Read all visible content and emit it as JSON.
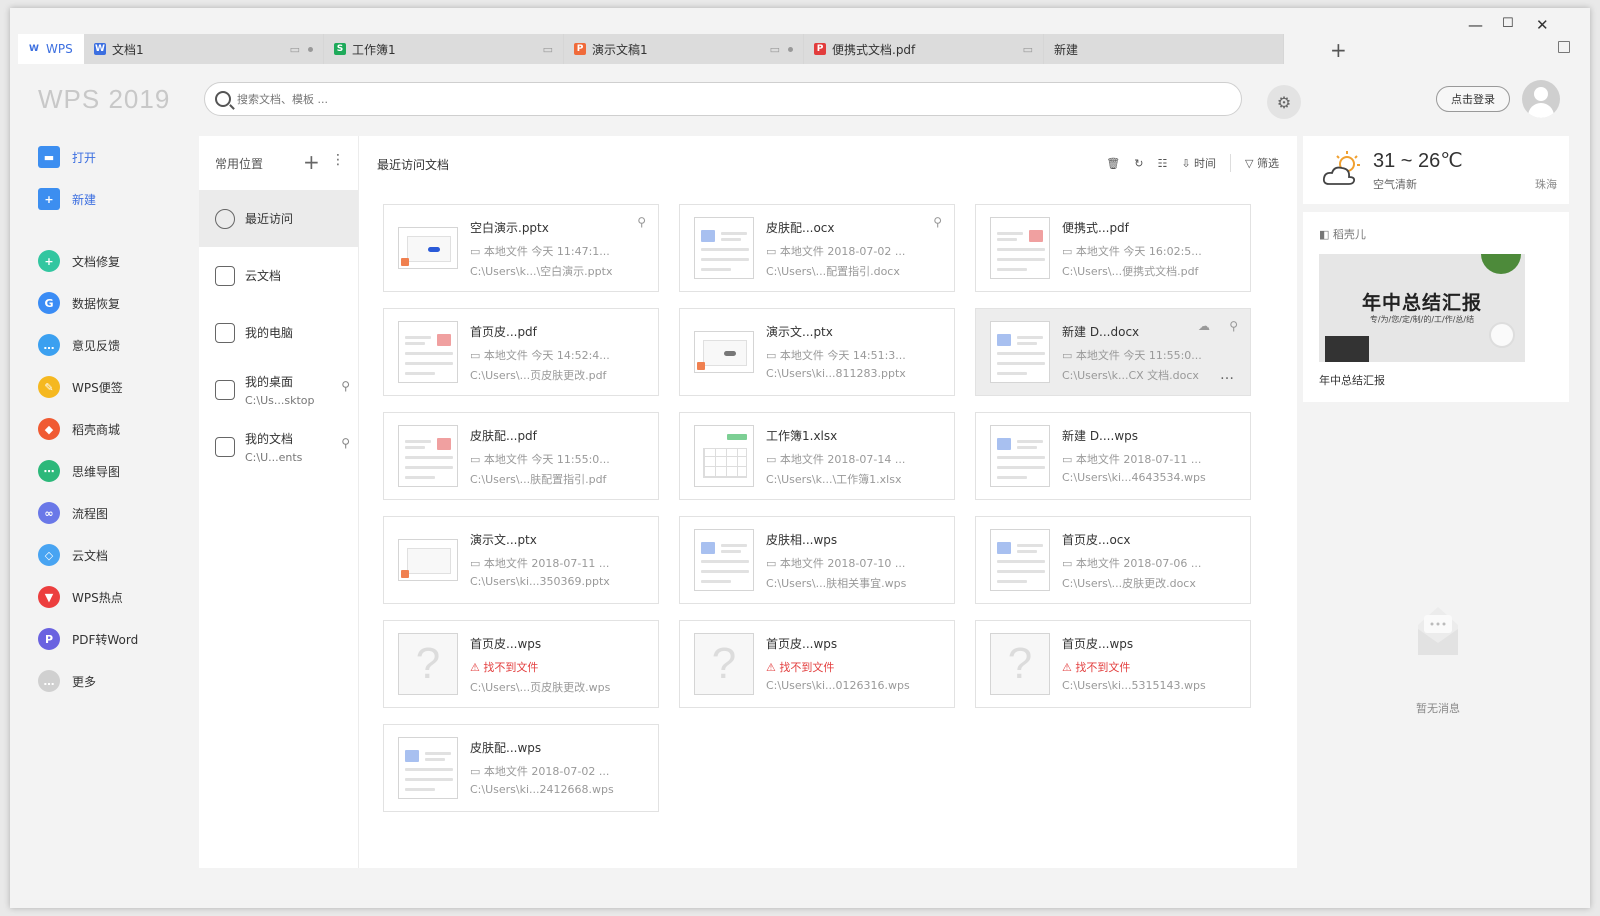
{
  "app": {
    "logo_text": "WPS 2019"
  },
  "tabs": [
    {
      "label": "WPS",
      "kind": "home",
      "color": "#3c6fe0",
      "icon": "W"
    },
    {
      "label": "文档1",
      "kind": "doc",
      "color": "#3c6fe0",
      "icon": "W"
    },
    {
      "label": "工作簿1",
      "kind": "sheet",
      "color": "#1eaa5a",
      "icon": "S"
    },
    {
      "label": "演示文稿1",
      "kind": "ppt",
      "color": "#f06a3a",
      "icon": "P"
    },
    {
      "label": "便携式文档.pdf",
      "kind": "pdf",
      "color": "#e23c3c",
      "icon": "P"
    },
    {
      "label": "新建",
      "kind": "new",
      "color": "",
      "icon": ""
    }
  ],
  "search": {
    "placeholder": "搜索文档、模板 ..."
  },
  "header": {
    "login_label": "点击登录"
  },
  "leftnav": [
    {
      "label": "打开",
      "icon": "folder-icon",
      "color": "#3c8ef0",
      "accent": true
    },
    {
      "label": "新建",
      "icon": "plus-icon",
      "color": "#3c8ef0",
      "accent": true
    },
    {
      "label": "文档修复",
      "icon": "repair-icon",
      "color": "#32c6a0"
    },
    {
      "label": "数据恢复",
      "icon": "recover-icon",
      "color": "#3a8cf5"
    },
    {
      "label": "意见反馈",
      "icon": "feedback-icon",
      "color": "#3ba0f0"
    },
    {
      "label": "WPS便签",
      "icon": "note-icon",
      "color": "#f5b820"
    },
    {
      "label": "稻壳商城",
      "icon": "shop-icon",
      "color": "#f05a32"
    },
    {
      "label": "思维导图",
      "icon": "mindmap-icon",
      "color": "#2cb87a"
    },
    {
      "label": "流程图",
      "icon": "flowchart-icon",
      "color": "#6a78e8"
    },
    {
      "label": "云文档",
      "icon": "cloud-doc-icon",
      "color": "#48a4f2"
    },
    {
      "label": "WPS热点",
      "icon": "hot-icon",
      "color": "#ec3e3e"
    },
    {
      "label": "PDF转Word",
      "icon": "pdf-word-icon",
      "color": "#6a62e0"
    },
    {
      "label": "更多",
      "icon": "more-icon",
      "color": "#d0d0d0"
    }
  ],
  "places": {
    "title": "常用位置",
    "items": [
      {
        "label": "最近访问",
        "sub": "",
        "icon": "clock-icon"
      },
      {
        "label": "云文档",
        "sub": "",
        "icon": "box-icon"
      },
      {
        "label": "我的电脑",
        "sub": "",
        "icon": "computer-icon"
      },
      {
        "label": "我的桌面",
        "sub": "C:\\Us...sktop",
        "icon": "desktop-icon"
      },
      {
        "label": "我的文档",
        "sub": "C:\\U...ents",
        "icon": "documents-icon"
      }
    ]
  },
  "content": {
    "title": "最近访问文档",
    "sort_label": "时间",
    "filter_label": "筛选"
  },
  "files": [
    {
      "name": "空白演示.pptx",
      "meta": "本地文件  今天 11:47:1...",
      "path": "C:\\Users\\k...\\空白演示.pptx",
      "type": "ppt",
      "pinned": true
    },
    {
      "name": "皮肤配...ocx",
      "meta": "本地文件  2018-07-02 ...",
      "path": "C:\\Users\\...配置指引.docx",
      "type": "doc",
      "pinned": true
    },
    {
      "name": "便携式...pdf",
      "meta": "本地文件  今天 16:02:5...",
      "path": "C:\\Users\\...便携式文档.pdf",
      "type": "pdf"
    },
    {
      "name": "首页皮...pdf",
      "meta": "本地文件  今天 14:52:4...",
      "path": "C:\\Users\\...页皮肤更改.pdf",
      "type": "pdf"
    },
    {
      "name": "演示文...ptx",
      "meta": "本地文件  今天 14:51:3...",
      "path": "C:\\Users\\ki...811283.pptx",
      "type": "ppt2"
    },
    {
      "name": "新建 D...docx",
      "meta": "本地文件  今天 11:55:0...",
      "path": "C:\\Users\\k...CX 文档.docx",
      "type": "doc",
      "hover": true
    },
    {
      "name": "皮肤配...pdf",
      "meta": "本地文件  今天 11:55:0...",
      "path": "C:\\Users\\...肤配置指引.pdf",
      "type": "pdf"
    },
    {
      "name": "工作簿1.xlsx",
      "meta": "本地文件  2018-07-14 ...",
      "path": "C:\\Users\\k...\\工作簿1.xlsx",
      "type": "xls"
    },
    {
      "name": "新建 D....wps",
      "meta": "本地文件  2018-07-11 ...",
      "path": "C:\\Users\\ki...4643534.wps",
      "type": "doc"
    },
    {
      "name": "演示文...ptx",
      "meta": "本地文件  2018-07-11 ...",
      "path": "C:\\Users\\ki...350369.pptx",
      "type": "pptb"
    },
    {
      "name": "皮肤相...wps",
      "meta": "本地文件  2018-07-10 ...",
      "path": "C:\\Users\\...肤相关事宜.wps",
      "type": "doc"
    },
    {
      "name": "首页皮...ocx",
      "meta": "本地文件  2018-07-06 ...",
      "path": "C:\\Users\\...皮肤更改.docx",
      "type": "doc"
    },
    {
      "name": "首页皮...wps",
      "meta": "找不到文件",
      "path": "C:\\Users\\...页皮肤更改.wps",
      "type": "missing"
    },
    {
      "name": "首页皮...wps",
      "meta": "找不到文件",
      "path": "C:\\Users\\ki...0126316.wps",
      "type": "missing"
    },
    {
      "name": "首页皮...wps",
      "meta": "找不到文件",
      "path": "C:\\Users\\ki...5315143.wps",
      "type": "missing"
    },
    {
      "name": "皮肤配...wps",
      "meta": "本地文件  2018-07-02 ...",
      "path": "C:\\Users\\ki...2412668.wps",
      "type": "doc"
    }
  ],
  "weather": {
    "temp": "31 ~ 26℃",
    "quality": "空气清新",
    "city": "珠海"
  },
  "promo": {
    "label": "稻壳儿",
    "title": "年中总结汇报",
    "subtitle": "专/为/您/定/制/的/工/作/总/结",
    "caption": "年中总结汇报"
  },
  "messages": {
    "empty_label": "暂无消息"
  }
}
